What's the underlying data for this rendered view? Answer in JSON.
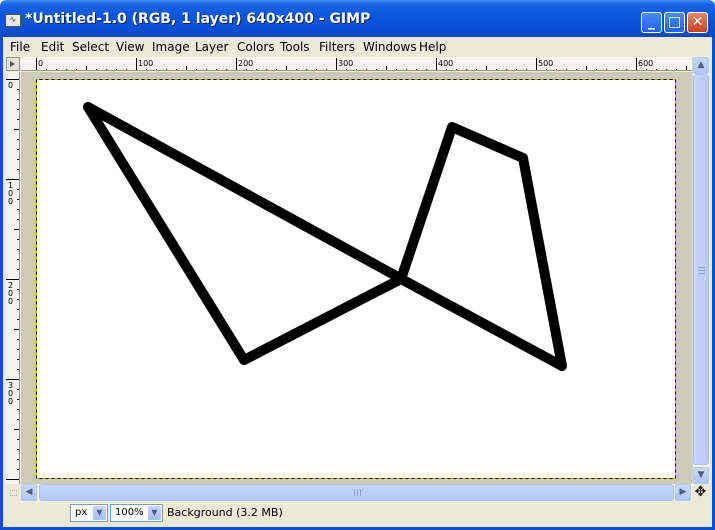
{
  "window": {
    "title": "*Untitled-1.0 (RGB, 1 layer) 640x400 - GIMP",
    "app_icon": "gimp-icon",
    "minimize": "_",
    "maximize": "□",
    "close": "✕"
  },
  "menu": {
    "items": [
      "File",
      "Edit",
      "Select",
      "View",
      "Image",
      "Layer",
      "Colors",
      "Tools",
      "Filters",
      "Windows",
      "Help"
    ]
  },
  "rulers": {
    "horizontal_labels": [
      "0",
      "100",
      "200",
      "300",
      "400",
      "500",
      "600"
    ],
    "vertical_labels": [
      "0",
      "100",
      "200",
      "300"
    ]
  },
  "canvas": {
    "image_width": 640,
    "image_height": 400,
    "background_color": "#ffffff",
    "stroke_color": "#000000",
    "paths": [
      [
        [
          52,
          28
        ],
        [
          393,
          215
        ]
      ],
      [
        [
          52,
          28
        ],
        [
          208,
          281
        ],
        [
          365,
          200
        ],
        [
          416,
          48
        ],
        [
          487,
          79
        ],
        [
          526,
          287
        ],
        [
          365,
          200
        ]
      ]
    ]
  },
  "statusbar": {
    "unit": "px",
    "zoom": "100%",
    "text": "Background (3.2 MB)"
  },
  "colors": {
    "titlebar": "#0a55dd",
    "window_frame": "#0a4fd2",
    "chrome": "#ece9d8",
    "canvas_surround": "#cdcab8"
  }
}
